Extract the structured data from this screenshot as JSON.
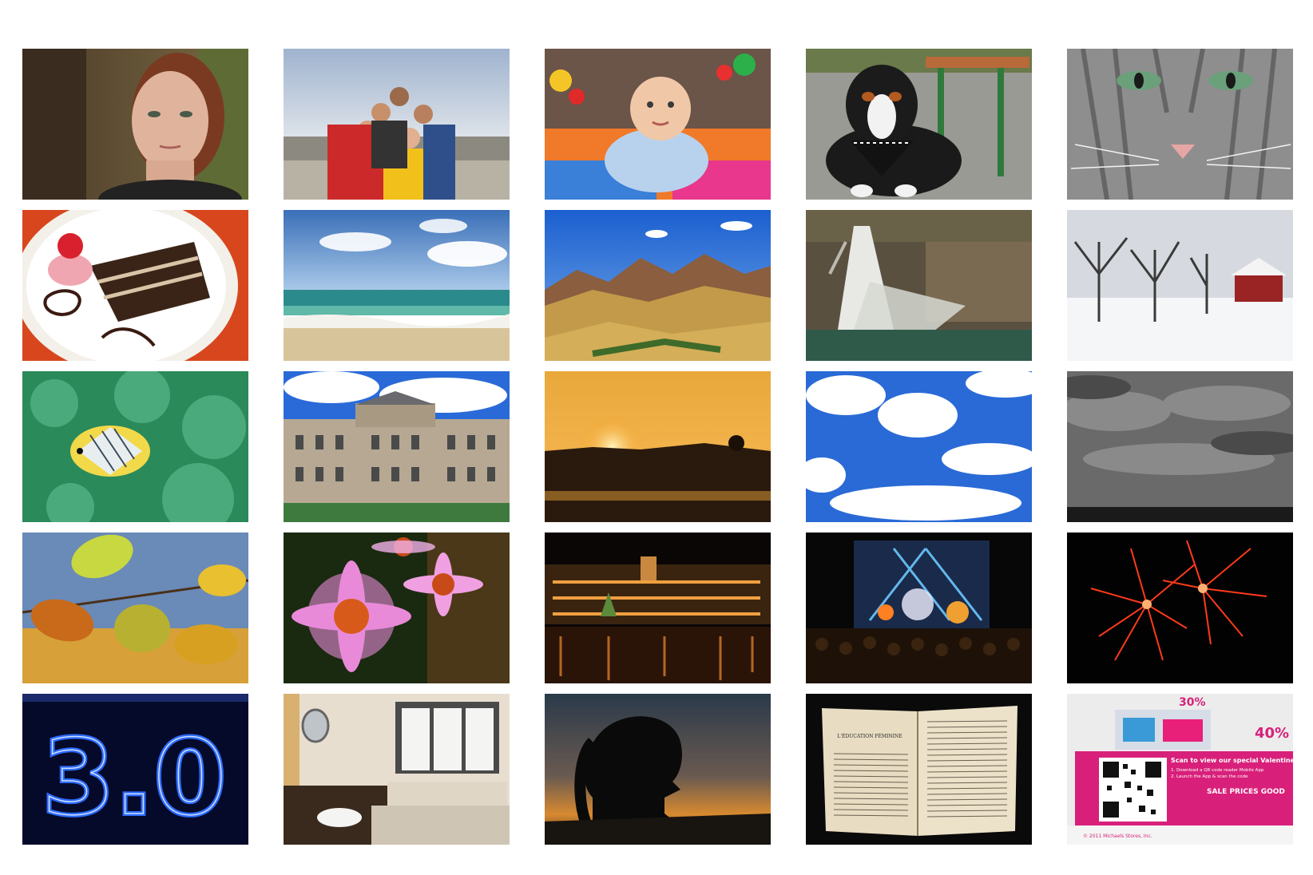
{
  "gallery": {
    "rows": 5,
    "columns": 5,
    "photos": [
      {
        "id": "portrait-woman",
        "subject": "portrait"
      },
      {
        "id": "group-selfie",
        "subject": "people"
      },
      {
        "id": "baby-on-playmat",
        "subject": "baby"
      },
      {
        "id": "bernese-dog-bandana",
        "subject": "dog"
      },
      {
        "id": "tabby-cat-face",
        "subject": "cat"
      },
      {
        "id": "chocolate-cake-plate",
        "subject": "food"
      },
      {
        "id": "tropical-beach",
        "subject": "beach"
      },
      {
        "id": "mountain-range",
        "subject": "mountains"
      },
      {
        "id": "waterfall-canyon",
        "subject": "waterfall"
      },
      {
        "id": "snowy-barn",
        "subject": "snow"
      },
      {
        "id": "butterflyfish-reef",
        "subject": "underwater"
      },
      {
        "id": "palace-building",
        "subject": "architecture"
      },
      {
        "id": "sunset-hills",
        "subject": "sunset"
      },
      {
        "id": "blue-sky-clouds",
        "subject": "sky"
      },
      {
        "id": "overcast-storm-clouds",
        "subject": "clouds"
      },
      {
        "id": "autumn-leaves",
        "subject": "leaves"
      },
      {
        "id": "pink-coneflowers",
        "subject": "flowers"
      },
      {
        "id": "harbor-night-lights",
        "subject": "city-night"
      },
      {
        "id": "concert-stage",
        "subject": "concert"
      },
      {
        "id": "red-fireworks",
        "subject": "fireworks"
      },
      {
        "id": "neon-3-0-sign",
        "subject": "neon-sign"
      },
      {
        "id": "hotel-bathroom",
        "subject": "interior"
      },
      {
        "id": "silhouette-sunset",
        "subject": "silhouette"
      },
      {
        "id": "open-book",
        "subject": "document"
      },
      {
        "id": "flyer-qr-code",
        "subject": "printed-ad"
      }
    ]
  },
  "text": {
    "neon_sign": "3.0",
    "book_heading": "L'ÉDUCATION FÉMININE",
    "flyer_scan": "Scan to view our special Valentine",
    "flyer_steps": "1. Download a QR code reader Mobile App",
    "flyer_steps2": "2. Launch the App & scan the code",
    "flyer_sale": "SALE PRICES GOOD",
    "flyer_percent_a": "30%",
    "flyer_percent_b": "40%",
    "flyer_copyright": "© 2011 Michaels Stores, Inc."
  },
  "colors": {
    "background": "#ffffff",
    "neon_blue": "#2d6bff",
    "flyer_pink": "#d8207a",
    "firework_red": "#ff3a1a",
    "sunset_orange": "#f59a18"
  }
}
